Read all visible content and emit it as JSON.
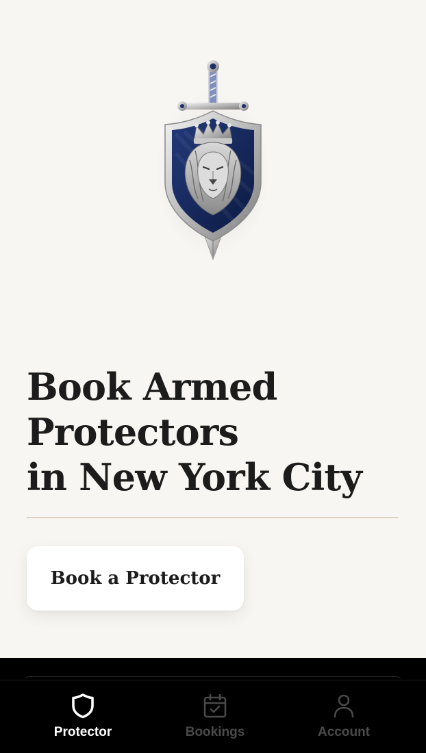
{
  "logo": {
    "icon": "lion-shield-sword-emblem"
  },
  "hero": {
    "headline_lines": [
      "Book Armed",
      "Protectors",
      "in New York City"
    ]
  },
  "cta": {
    "label": "Book a Protector"
  },
  "tabbar": {
    "tabs": [
      {
        "label": "Protector",
        "icon": "shield-icon",
        "active": true
      },
      {
        "label": "Bookings",
        "icon": "calendar-check-icon",
        "active": false
      },
      {
        "label": "Account",
        "icon": "person-icon",
        "active": false
      }
    ]
  },
  "colors": {
    "background": "#f8f6f2",
    "text": "#1c1c1c",
    "divider": "#b8a888",
    "shield_navy": "#14265a",
    "tab_active": "#ffffff",
    "tab_inactive": "#4a4a4a"
  }
}
